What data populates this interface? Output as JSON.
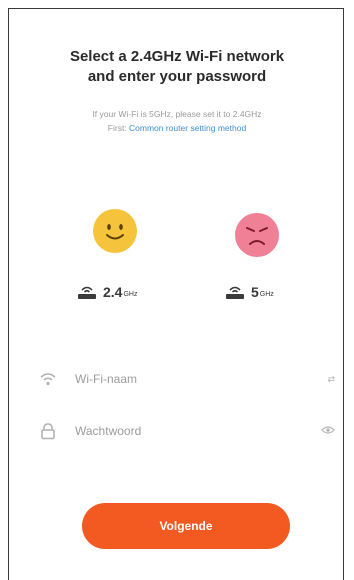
{
  "header": {
    "title_line1": "Select a 2.4GHz Wi-Fi network",
    "title_line2": "and enter your password"
  },
  "hint": {
    "line1": "If your Wi-Fi is 5GHz, please set it to 2.4GHz",
    "line2_prefix": "First: ",
    "link_text": "Common router setting method"
  },
  "bands": [
    {
      "num": "2.4",
      "unit": "GHz",
      "status": "supported",
      "face_icon": "happy-face-icon"
    },
    {
      "num": "5",
      "unit": "GHz",
      "status": "unsupported",
      "face_icon": "sad-face-icon"
    }
  ],
  "form": {
    "ssid_placeholder": "Wi-Fi-naam",
    "ssid_trailing": "⇄",
    "password_placeholder": "Wachtwoord"
  },
  "next_button_label": "Volgende",
  "colors": {
    "accent": "#f25a22",
    "good": "#f6c33c",
    "bad": "#f08095",
    "link": "#3d8fd6"
  }
}
